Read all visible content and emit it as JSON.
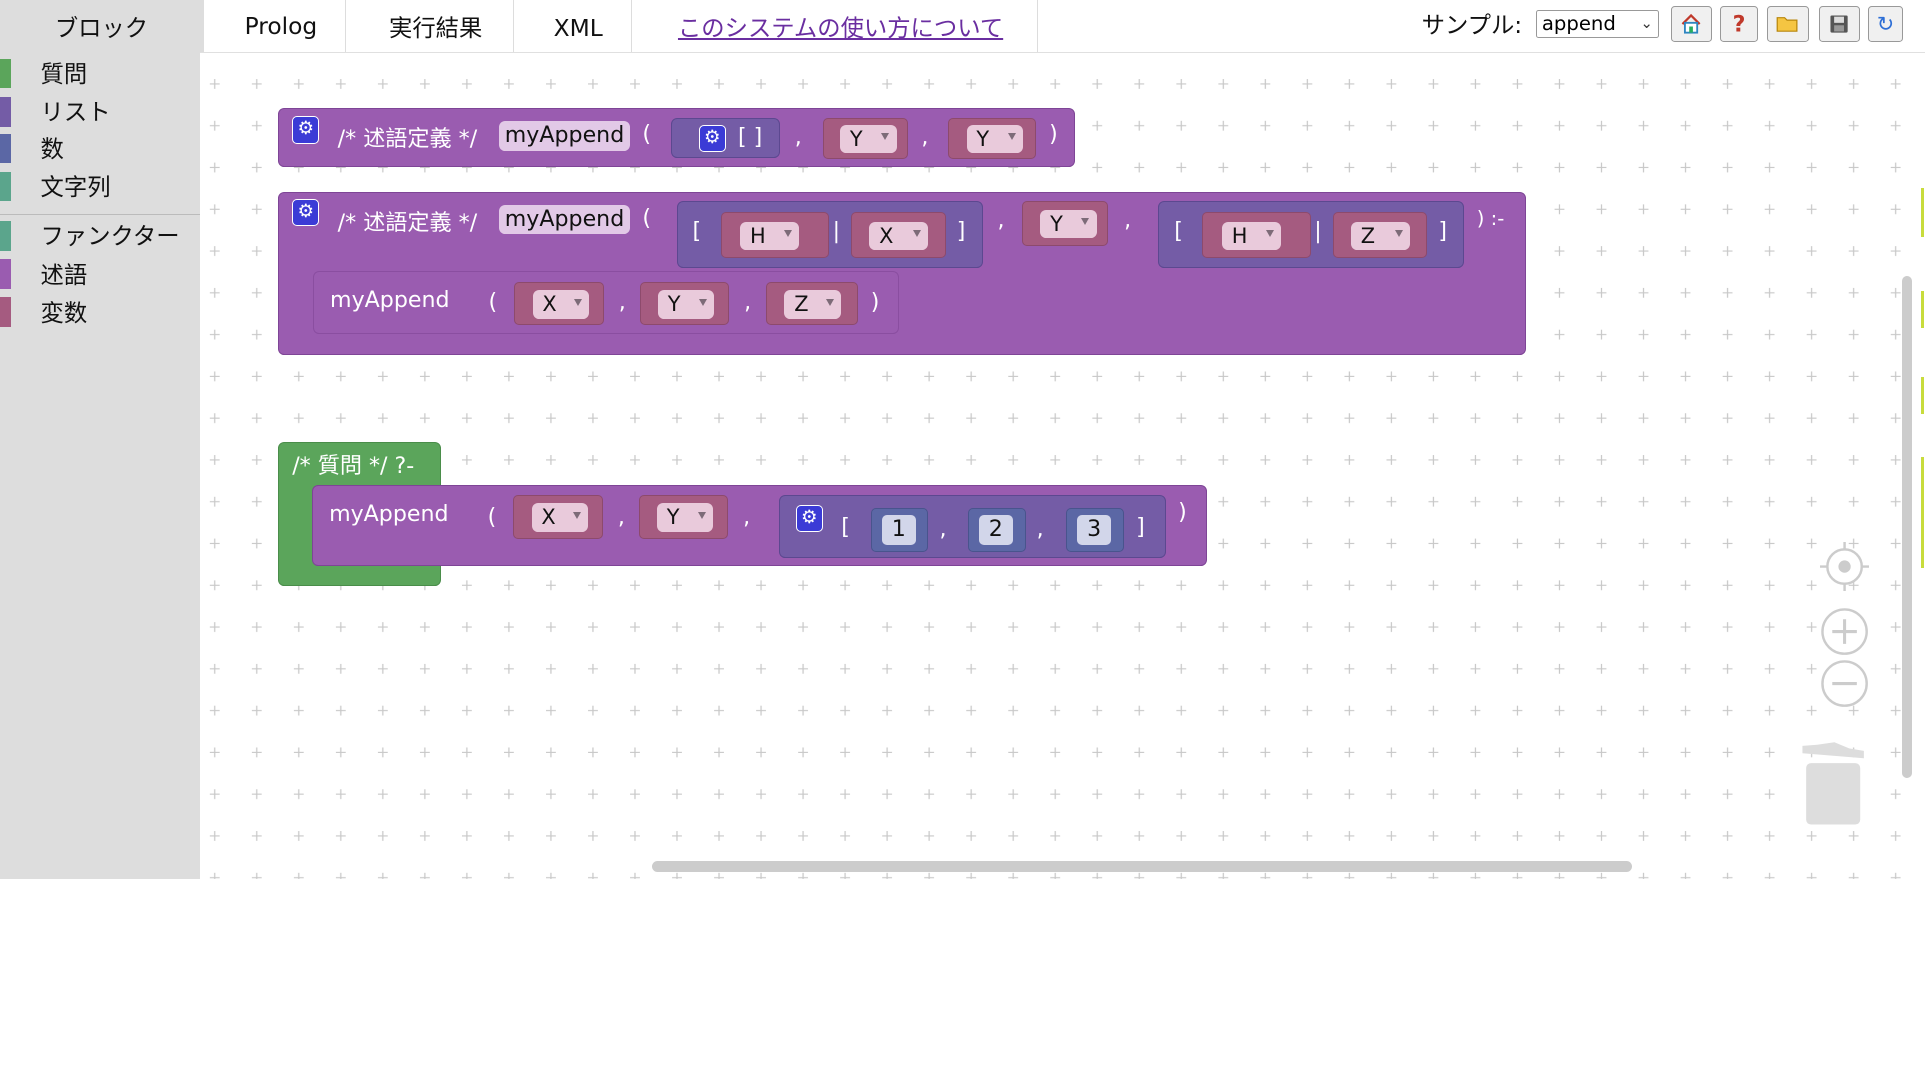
{
  "tabs": [
    {
      "label": "ブロック",
      "active": true
    },
    {
      "label": "Prolog"
    },
    {
      "label": "実行結果"
    },
    {
      "label": "XML"
    },
    {
      "label": "このシステムの使い方について"
    }
  ],
  "sample": {
    "label": "サンプル:",
    "value": "append"
  },
  "toolbar_icons": [
    "home-icon",
    "help-icon",
    "folder-open-icon",
    "save-icon",
    "refresh-icon"
  ],
  "toolbox": {
    "categories": [
      {
        "label": "質問",
        "color": "#5ba55b"
      },
      {
        "label": "リスト",
        "color": "#745ca6"
      },
      {
        "label": "数",
        "color": "#5b67a5"
      },
      {
        "label": "文字列",
        "color": "#5ba58c"
      },
      {
        "label": "ファンクター",
        "color": "#5ba58c"
      },
      {
        "label": "述語",
        "color": "#9a5cb0"
      },
      {
        "label": "変数",
        "color": "#a55b80"
      }
    ]
  },
  "blocks": {
    "def_comment": "/* 述語定義 */",
    "pred_name": "myAppend",
    "open_paren": "(",
    "close_paren": ")",
    "comma": ",",
    "lbr": "[",
    "rbr": "]",
    "bar": "|",
    "empty_list": "[ ]",
    "neck": ") :-",
    "query_comment": "/* 質問 */ ?-",
    "vars": {
      "H": "H",
      "X": "X",
      "Y": "Y",
      "Z": "Z"
    },
    "nums": [
      "1",
      "2",
      "3"
    ]
  },
  "colors": {
    "predicate": "#9a5cb0",
    "question": "#5ba55b",
    "list": "#745ca6",
    "variable": "#a55b80",
    "number": "#5b67a5"
  }
}
